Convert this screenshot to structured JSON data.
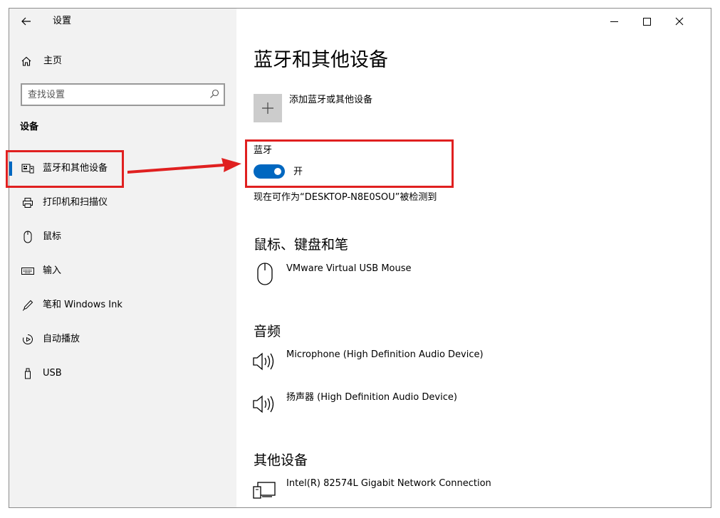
{
  "titlebar": {
    "app_title": "设置",
    "back_icon": "arrow-left-icon",
    "controls": [
      "minimize-icon",
      "maximize-icon",
      "close-icon"
    ]
  },
  "sidebar": {
    "home_label": "主页",
    "search_placeholder": "查找设置",
    "section_title": "设备",
    "items": [
      {
        "label": "蓝牙和其他设备",
        "icon": "bluetooth-devices-icon",
        "selected": true
      },
      {
        "label": "打印机和扫描仪",
        "icon": "printer-icon"
      },
      {
        "label": "鼠标",
        "icon": "mouse-icon"
      },
      {
        "label": "输入",
        "icon": "keyboard-icon"
      },
      {
        "label": "笔和 Windows Ink",
        "icon": "pen-icon"
      },
      {
        "label": "自动播放",
        "icon": "autoplay-icon"
      },
      {
        "label": "USB",
        "icon": "usb-icon"
      }
    ]
  },
  "main": {
    "title": "蓝牙和其他设备",
    "add_device_label": "添加蓝牙或其他设备",
    "bluetooth": {
      "label": "蓝牙",
      "state_label": "开",
      "on": true,
      "discoverable_text": "现在可作为“DESKTOP-N8E0SOU”被检测到"
    },
    "sections": [
      {
        "title": "鼠标、键盘和笔",
        "devices": [
          {
            "name": "VMware Virtual USB Mouse",
            "icon": "mouse-icon"
          }
        ]
      },
      {
        "title": "音频",
        "devices": [
          {
            "name": "Microphone (High Definition Audio Device)",
            "icon": "speaker-icon"
          },
          {
            "name": "扬声器 (High Definition Audio Device)",
            "icon": "speaker-icon"
          }
        ]
      },
      {
        "title": "其他设备",
        "devices": [
          {
            "name": "Intel(R) 82574L Gigabit Network Connection",
            "icon": "network-device-icon"
          }
        ]
      }
    ]
  },
  "colors": {
    "accent": "#0067c0",
    "annotation_red": "#e02020",
    "sidebar_bg": "#f2f2f2"
  }
}
